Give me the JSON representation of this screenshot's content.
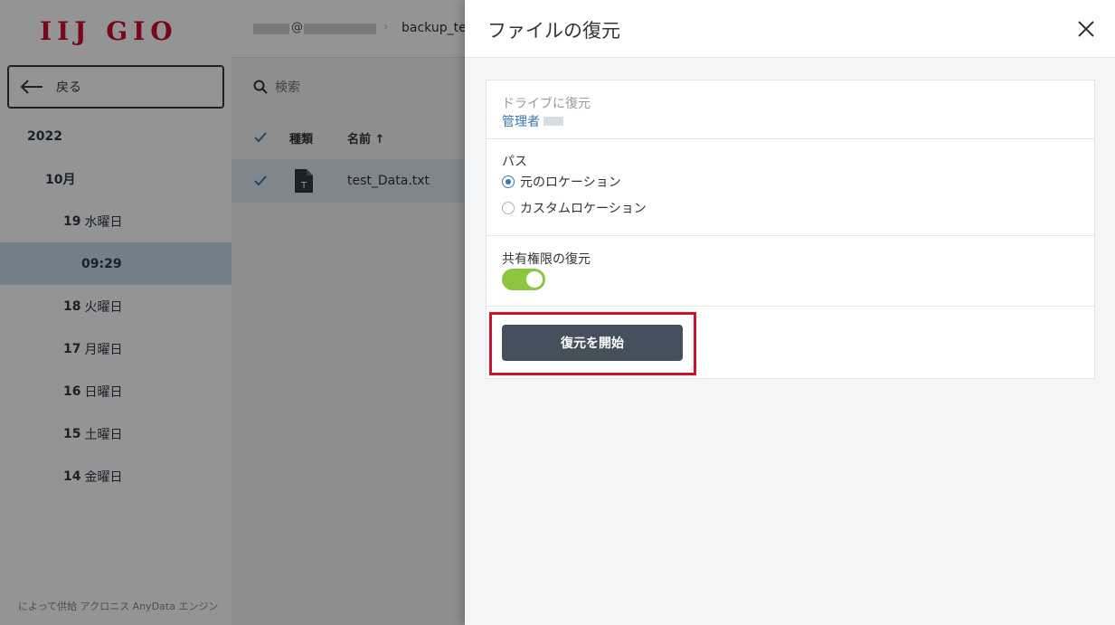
{
  "sidebar": {
    "logo": "IIJ GIO",
    "back_label": "戻る",
    "tree": [
      {
        "bold": "2022",
        "rest": ""
      },
      {
        "bold": "10月",
        "rest": ""
      },
      {
        "bold": "19",
        "rest": "水曜日"
      },
      {
        "bold": "09:29",
        "rest": ""
      },
      {
        "bold": "18",
        "rest": "火曜日"
      },
      {
        "bold": "17",
        "rest": "月曜日"
      },
      {
        "bold": "16",
        "rest": "日曜日"
      },
      {
        "bold": "15",
        "rest": "土曜日"
      },
      {
        "bold": "14",
        "rest": "金曜日"
      }
    ],
    "footer": "によって供給 アクロニス AnyData エンジン"
  },
  "main": {
    "breadcrumb_at": "@",
    "breadcrumb_folder": "backup_tes",
    "search_placeholder": "検索",
    "columns": {
      "type": "種類",
      "name": "名前 ↑"
    },
    "rows": [
      {
        "name": "test_Data.txt",
        "file_icon_letter": "T"
      }
    ]
  },
  "panel": {
    "title": "ファイルの復元",
    "drive_label": "ドライブに復元",
    "drive_value": "管理者",
    "path_label": "パス",
    "path_options": [
      "元のロケーション",
      "カスタムロケーション"
    ],
    "sharing_label": "共有権限の復元",
    "sharing_enabled": true,
    "start_button": "復元を開始"
  },
  "colors": {
    "logo": "#c8102e",
    "toggle_on": "#8cc63f",
    "button_bg": "#46505c",
    "link": "#3a76b0",
    "highlight": "#d0112b"
  }
}
